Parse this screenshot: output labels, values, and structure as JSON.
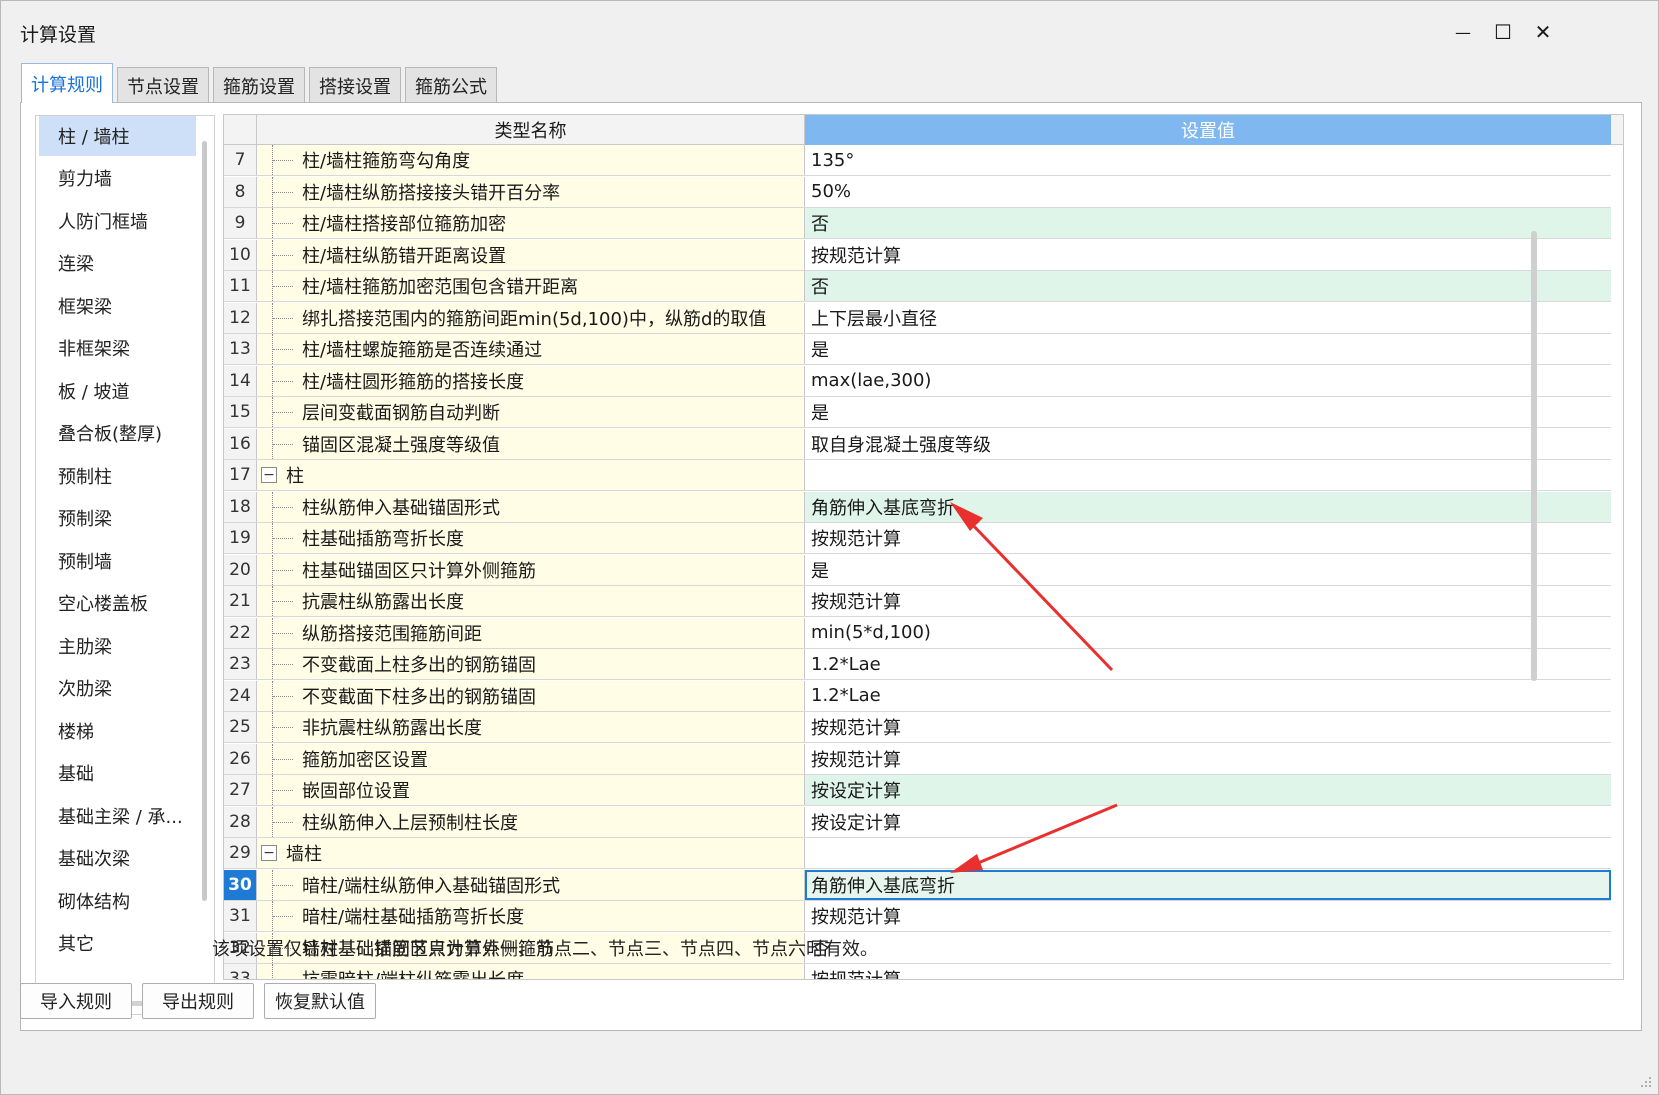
{
  "window": {
    "title": "计算设置",
    "minimize_glyph": "—",
    "maximize_glyph": "☐",
    "close_glyph": "✕"
  },
  "tabs": [
    {
      "label": "计算规则",
      "active": true
    },
    {
      "label": "节点设置",
      "active": false
    },
    {
      "label": "箍筋设置",
      "active": false
    },
    {
      "label": "搭接设置",
      "active": false
    },
    {
      "label": "箍筋公式",
      "active": false
    }
  ],
  "sidebar": {
    "items": [
      {
        "label": "柱 / 墙柱",
        "selected": true
      },
      {
        "label": "剪力墙"
      },
      {
        "label": "人防门框墙"
      },
      {
        "label": "连梁"
      },
      {
        "label": "框架梁"
      },
      {
        "label": "非框架梁"
      },
      {
        "label": "板 / 坡道"
      },
      {
        "label": "叠合板(整厚)"
      },
      {
        "label": "预制柱"
      },
      {
        "label": "预制梁"
      },
      {
        "label": "预制墙"
      },
      {
        "label": "空心楼盖板"
      },
      {
        "label": "主肋梁"
      },
      {
        "label": "次肋梁"
      },
      {
        "label": "楼梯"
      },
      {
        "label": "基础"
      },
      {
        "label": "基础主梁 / 承..."
      },
      {
        "label": "基础次梁"
      },
      {
        "label": "砌体结构"
      },
      {
        "label": "其它"
      }
    ]
  },
  "grid": {
    "col_name_header": "类型名称",
    "col_value_header": "设置值",
    "expander_glyph": "−",
    "rows": [
      {
        "num": "7",
        "name": "柱/墙柱箍筋弯勾角度",
        "value": "135°"
      },
      {
        "num": "8",
        "name": "柱/墙柱纵筋搭接接头错开百分率",
        "value": "50%"
      },
      {
        "num": "9",
        "name": "柱/墙柱搭接部位箍筋加密",
        "value": "否",
        "highlight": true
      },
      {
        "num": "10",
        "name": "柱/墙柱纵筋错开距离设置",
        "value": "按规范计算"
      },
      {
        "num": "11",
        "name": "柱/墙柱箍筋加密范围包含错开距离",
        "value": "否",
        "highlight": true
      },
      {
        "num": "12",
        "name": "绑扎搭接范围内的箍筋间距min(5d,100)中，纵筋d的取值",
        "value": "上下层最小直径"
      },
      {
        "num": "13",
        "name": "柱/墙柱螺旋箍筋是否连续通过",
        "value": "是"
      },
      {
        "num": "14",
        "name": "柱/墙柱圆形箍筋的搭接长度",
        "value": "max(lae,300)"
      },
      {
        "num": "15",
        "name": "层间变截面钢筋自动判断",
        "value": "是"
      },
      {
        "num": "16",
        "name": "锚固区混凝土强度等级值",
        "value": "取自身混凝土强度等级"
      },
      {
        "num": "17",
        "name": "柱",
        "value": "",
        "group": true
      },
      {
        "num": "18",
        "name": "柱纵筋伸入基础锚固形式",
        "value": "角筋伸入基底弯折",
        "highlight": true
      },
      {
        "num": "19",
        "name": "柱基础插筋弯折长度",
        "value": "按规范计算"
      },
      {
        "num": "20",
        "name": "柱基础锚固区只计算外侧箍筋",
        "value": "是"
      },
      {
        "num": "21",
        "name": "抗震柱纵筋露出长度",
        "value": "按规范计算"
      },
      {
        "num": "22",
        "name": "纵筋搭接范围箍筋间距",
        "value": "min(5*d,100)"
      },
      {
        "num": "23",
        "name": "不变截面上柱多出的钢筋锚固",
        "value": "1.2*Lae"
      },
      {
        "num": "24",
        "name": "不变截面下柱多出的钢筋锚固",
        "value": "1.2*Lae"
      },
      {
        "num": "25",
        "name": "非抗震柱纵筋露出长度",
        "value": "按规范计算"
      },
      {
        "num": "26",
        "name": "箍筋加密区设置",
        "value": "按规范计算"
      },
      {
        "num": "27",
        "name": "嵌固部位设置",
        "value": "按设定计算",
        "highlight": true
      },
      {
        "num": "28",
        "name": "柱纵筋伸入上层预制柱长度",
        "value": "按设定计算"
      },
      {
        "num": "29",
        "name": "墙柱",
        "value": "",
        "group": true
      },
      {
        "num": "30",
        "name": "暗柱/端柱纵筋伸入基础锚固形式",
        "value": "角筋伸入基底弯折",
        "selected": true
      },
      {
        "num": "31",
        "name": "暗柱/端柱基础插筋弯折长度",
        "value": "按规范计算"
      },
      {
        "num": "32",
        "name": "墙柱基础锚固区只计算外侧箍筋",
        "value": "否"
      },
      {
        "num": "33",
        "name": "抗震暗柱/端柱纵筋露出长度",
        "value": "按规范计算"
      }
    ]
  },
  "note": "该项设置仅针对基础插筋节点为节点一、节点二、节点三、节点四、节点六时有效。",
  "buttons": {
    "import": "导入规则",
    "export": "导出规则",
    "reset": "恢复默认值"
  },
  "colors": {
    "accent": "#1f7ad6",
    "header_value_bg": "#7fb8f0",
    "row_highlight": "#dff5ea",
    "name_col_bg": "#fffde6",
    "annotation_arrow": "#e8302f"
  }
}
